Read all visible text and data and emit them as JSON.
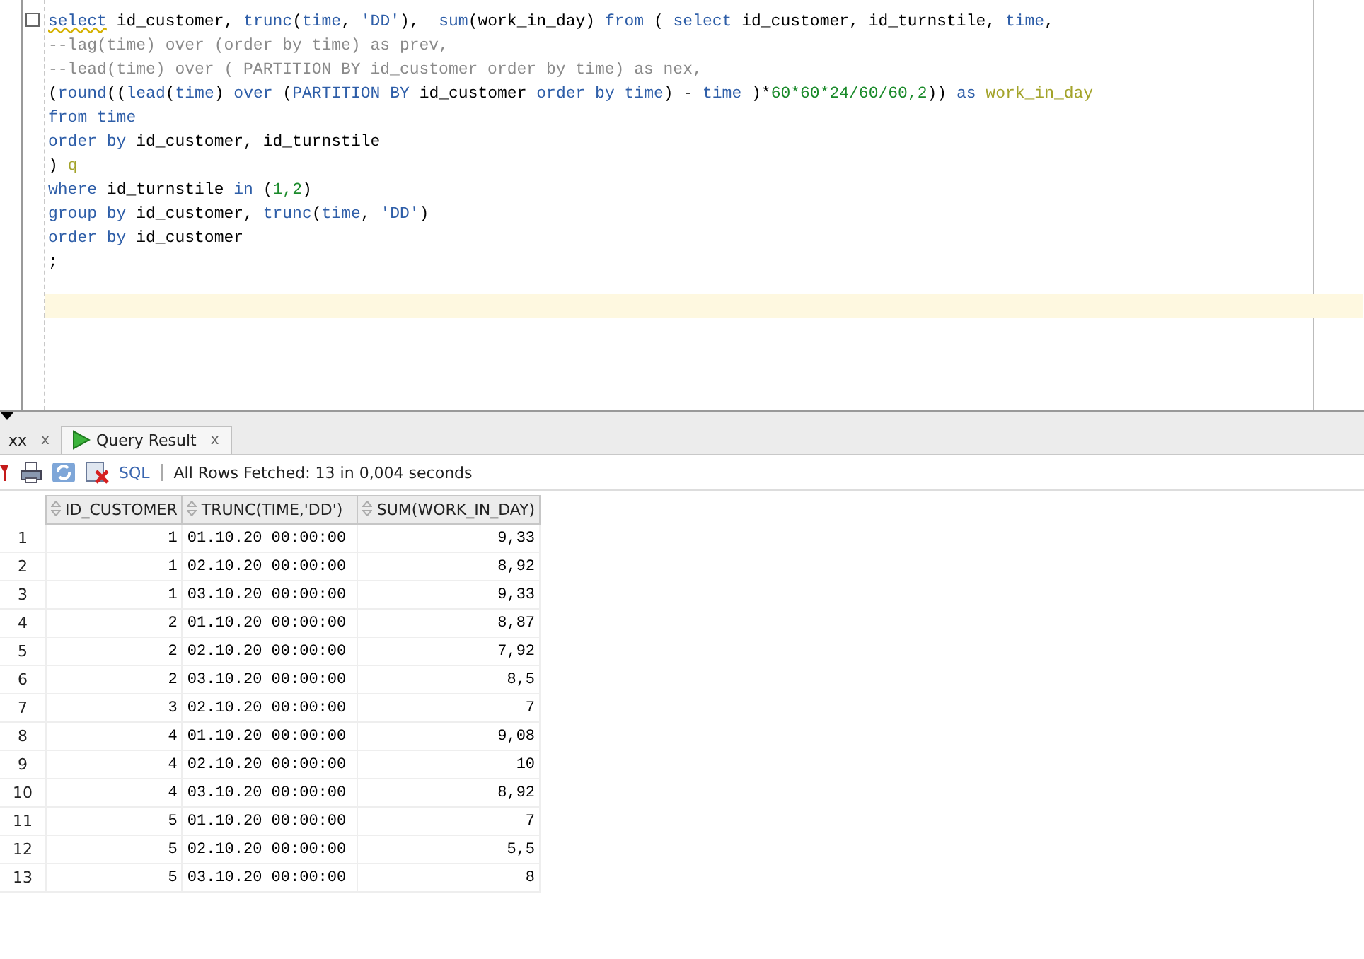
{
  "editor": {
    "lines": [
      [
        {
          "kind": "flagged",
          "text": "select"
        },
        {
          "kind": "plain",
          "text": " id_customer, "
        },
        {
          "kind": "keyword",
          "text": "trunc"
        },
        {
          "kind": "plain",
          "text": "("
        },
        {
          "kind": "keyword",
          "text": "time"
        },
        {
          "kind": "plain",
          "text": ", "
        },
        {
          "kind": "string",
          "text": "'DD'"
        },
        {
          "kind": "plain",
          "text": "),  "
        },
        {
          "kind": "keyword",
          "text": "sum"
        },
        {
          "kind": "plain",
          "text": "(work_in_day) "
        },
        {
          "kind": "keyword",
          "text": "from"
        },
        {
          "kind": "plain",
          "text": " ( "
        },
        {
          "kind": "keyword",
          "text": "select"
        },
        {
          "kind": "plain",
          "text": " id_customer, id_turnstile, "
        },
        {
          "kind": "keyword",
          "text": "time"
        },
        {
          "kind": "plain",
          "text": ","
        }
      ],
      [
        {
          "kind": "comment",
          "text": "--lag(time) over (order by time) as prev,"
        }
      ],
      [
        {
          "kind": "comment",
          "text": "--lead(time) over ( PARTITION BY id_customer order by time) as nex,"
        }
      ],
      [
        {
          "kind": "plain",
          "text": "("
        },
        {
          "kind": "keyword",
          "text": "round"
        },
        {
          "kind": "plain",
          "text": "(("
        },
        {
          "kind": "keyword",
          "text": "lead"
        },
        {
          "kind": "plain",
          "text": "("
        },
        {
          "kind": "keyword",
          "text": "time"
        },
        {
          "kind": "plain",
          "text": ") "
        },
        {
          "kind": "keyword",
          "text": "over"
        },
        {
          "kind": "plain",
          "text": " ("
        },
        {
          "kind": "keyword",
          "text": "PARTITION BY"
        },
        {
          "kind": "plain",
          "text": " id_customer "
        },
        {
          "kind": "keyword",
          "text": "order by "
        },
        {
          "kind": "keyword",
          "text": "time"
        },
        {
          "kind": "plain",
          "text": ") - "
        },
        {
          "kind": "keyword",
          "text": "time"
        },
        {
          "kind": "plain",
          "text": " )*"
        },
        {
          "kind": "number",
          "text": "60*60*24/60/60,2"
        },
        {
          "kind": "plain",
          "text": ")) "
        },
        {
          "kind": "keyword",
          "text": "as "
        },
        {
          "kind": "alias",
          "text": "work_in_day"
        }
      ],
      [
        {
          "kind": "keyword",
          "text": "from time"
        }
      ],
      [
        {
          "kind": "keyword",
          "text": "order by"
        },
        {
          "kind": "plain",
          "text": " id_customer, id_turnstile"
        }
      ],
      [
        {
          "kind": "plain",
          "text": ") "
        },
        {
          "kind": "alias",
          "text": "q"
        }
      ],
      [
        {
          "kind": "keyword",
          "text": "where"
        },
        {
          "kind": "plain",
          "text": " id_turnstile "
        },
        {
          "kind": "keyword",
          "text": "in"
        },
        {
          "kind": "plain",
          "text": " ("
        },
        {
          "kind": "number",
          "text": "1,2"
        },
        {
          "kind": "plain",
          "text": ")"
        }
      ],
      [
        {
          "kind": "keyword",
          "text": "group by"
        },
        {
          "kind": "plain",
          "text": " id_customer, "
        },
        {
          "kind": "keyword",
          "text": "trunc"
        },
        {
          "kind": "plain",
          "text": "("
        },
        {
          "kind": "keyword",
          "text": "time"
        },
        {
          "kind": "plain",
          "text": ", "
        },
        {
          "kind": "string",
          "text": "'DD'"
        },
        {
          "kind": "plain",
          "text": ")"
        }
      ],
      [
        {
          "kind": "keyword",
          "text": "order by"
        },
        {
          "kind": "plain",
          "text": " id_customer"
        }
      ],
      [
        {
          "kind": "plain",
          "text": ";"
        }
      ]
    ]
  },
  "tabs": [
    {
      "label": "xx",
      "close": "x",
      "selected": false
    },
    {
      "label": "Query Result",
      "close": "x",
      "selected": true
    }
  ],
  "status": "All Rows Fetched: 13 in 0,004 seconds",
  "sql_link": "SQL",
  "table": {
    "columns": [
      "",
      "ID_CUSTOMER",
      "TRUNC(TIME,'DD')",
      "SUM(WORK_IN_DAY)"
    ],
    "rows": [
      [
        "1",
        "1",
        "01.10.20 00:00:00",
        "9,33"
      ],
      [
        "2",
        "1",
        "02.10.20 00:00:00",
        "8,92"
      ],
      [
        "3",
        "1",
        "03.10.20 00:00:00",
        "9,33"
      ],
      [
        "4",
        "2",
        "01.10.20 00:00:00",
        "8,87"
      ],
      [
        "5",
        "2",
        "02.10.20 00:00:00",
        "7,92"
      ],
      [
        "6",
        "2",
        "03.10.20 00:00:00",
        "8,5"
      ],
      [
        "7",
        "3",
        "02.10.20 00:00:00",
        "7"
      ],
      [
        "8",
        "4",
        "01.10.20 00:00:00",
        "9,08"
      ],
      [
        "9",
        "4",
        "02.10.20 00:00:00",
        "10"
      ],
      [
        "10",
        "4",
        "03.10.20 00:00:00",
        "8,92"
      ],
      [
        "11",
        "5",
        "01.10.20 00:00:00",
        "7"
      ],
      [
        "12",
        "5",
        "02.10.20 00:00:00",
        "5,5"
      ],
      [
        "13",
        "5",
        "03.10.20 00:00:00",
        "8"
      ]
    ]
  }
}
